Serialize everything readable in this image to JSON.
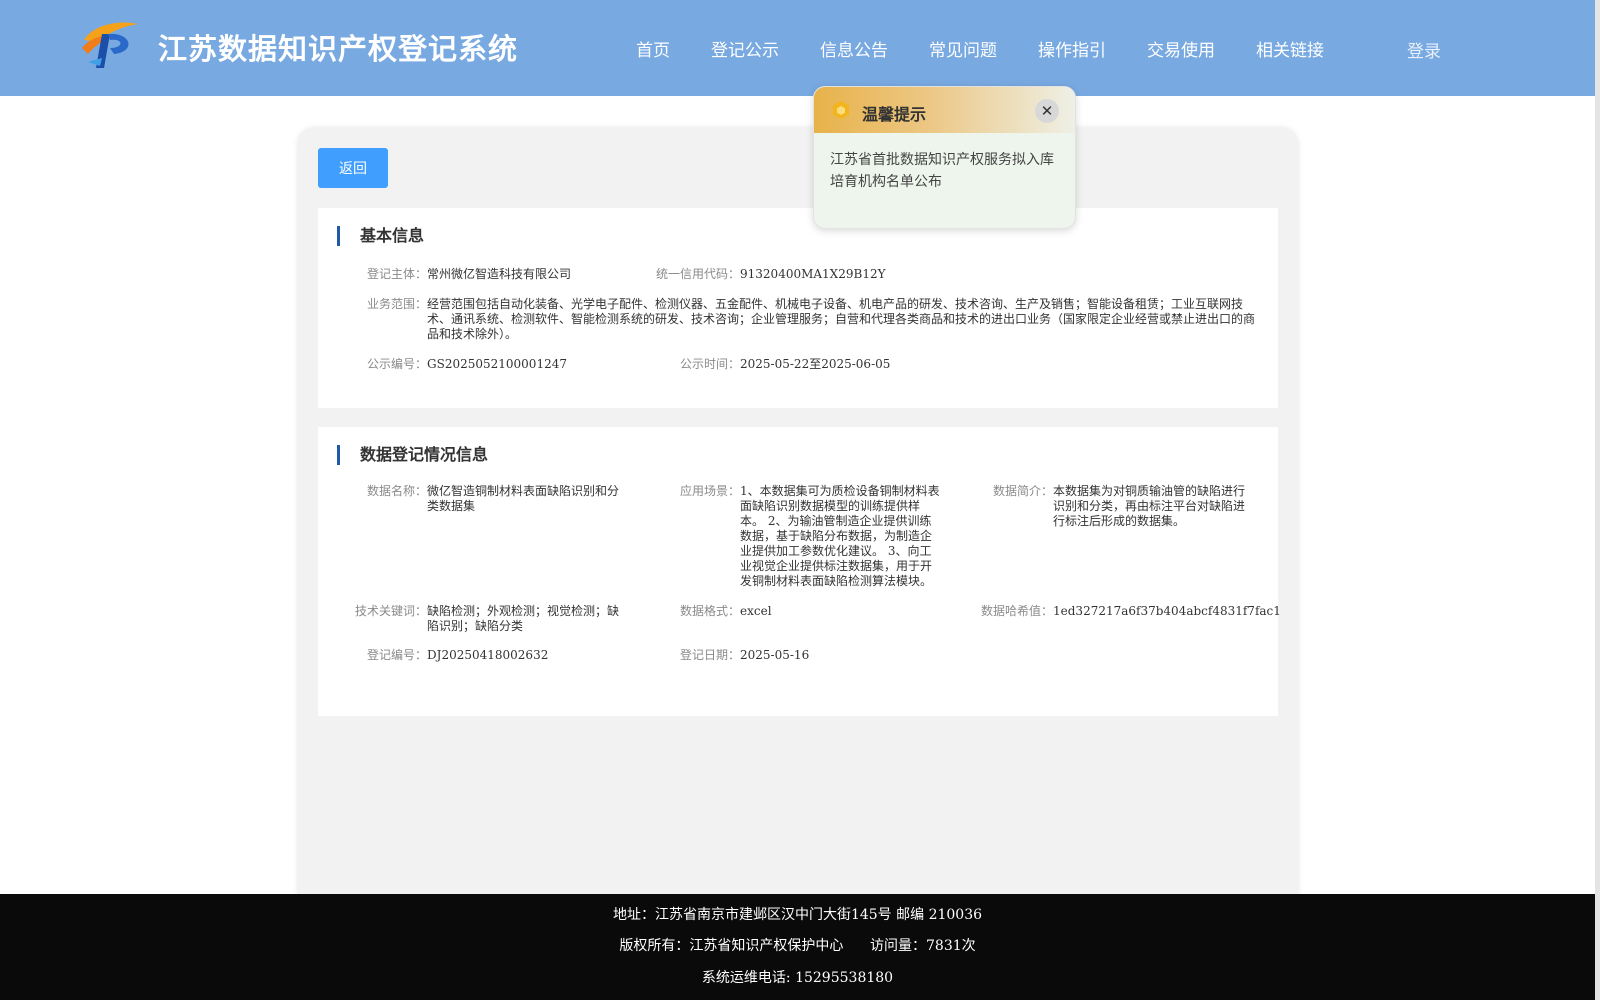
{
  "header": {
    "site_title": "江苏数据知识产权登记系统",
    "nav": [
      "首页",
      "登记公示",
      "信息公告",
      "常见问题",
      "操作指引",
      "交易使用",
      "相关链接"
    ],
    "login": "登录"
  },
  "main": {
    "back_label": "返回",
    "basic": {
      "title": "基本信息",
      "subject_label": "登记主体：",
      "subject": "常州微亿智造科技有限公司",
      "credit_label": "统一信用代码：",
      "credit": "91320400MA1X29B12Y",
      "scope_label": "业务范围：",
      "scope": "经营范围包括自动化装备、光学电子配件、检测仪器、五金配件、机械电子设备、机电产品的研发、技术咨询、生产及销售；智能设备租赁；工业互联网技术、通讯系统、检测软件、智能检测系统的研发、技术咨询；企业管理服务；自营和代理各类商品和技术的进出口业务（国家限定企业经营或禁止进出口的商品和技术除外）。",
      "pub_no_label": "公示编号：",
      "pub_no": "GS2025052100001247",
      "pub_time_label": "公示时间：",
      "pub_time": "2025-05-22至2025-06-05"
    },
    "data_reg": {
      "title": "数据登记情况信息",
      "name_label": "数据名称：",
      "name": "微亿智造铜制材料表面缺陷识别和分类数据集",
      "scene_label": "应用场景：",
      "scene": "1、本数据集可为质检设备铜制材料表面缺陷识别数据模型的训练提供样本。 2、为输油管制造企业提供训练数据，基于缺陷分布数据，为制造企业提供加工参数优化建议。 3、向工业视觉企业提供标注数据集，用于开发铜制材料表面缺陷检测算法模块。",
      "intro_label": "数据简介：",
      "intro": "本数据集为对铜质输油管的缺陷进行识别和分类，再由标注平台对缺陷进行标注后形成的数据集。",
      "keywords_label": "技术关键词：",
      "keywords": "缺陷检测；外观检测；视觉检测；缺陷识别；缺陷分类",
      "format_label": "数据格式：",
      "format": "excel",
      "hash_label": "数据哈希值：",
      "hash": "1ed327217a6f37b404abcf4831f7fac1",
      "reg_no_label": "登记编号：",
      "reg_no": "DJ20250418002632",
      "reg_date_label": "登记日期：",
      "reg_date": "2025-05-16"
    }
  },
  "popup": {
    "title": "温馨提示",
    "close": "✕",
    "body": "江苏省首批数据知识产权服务拟入库培育机构名单公布"
  },
  "footer": {
    "address": "地址：江苏省南京市建邺区汉中门大街145号 邮编 210036",
    "copyright": "版权所有：江苏省知识产权保护中心      访问量：7831次",
    "phone": "系统运维电话: 15295538180"
  },
  "colors": {
    "header_bg": "#78a9e0",
    "button_blue": "#409eff",
    "title_bar": "#1f5aa6",
    "footer_bg": "#0a0a0a"
  }
}
